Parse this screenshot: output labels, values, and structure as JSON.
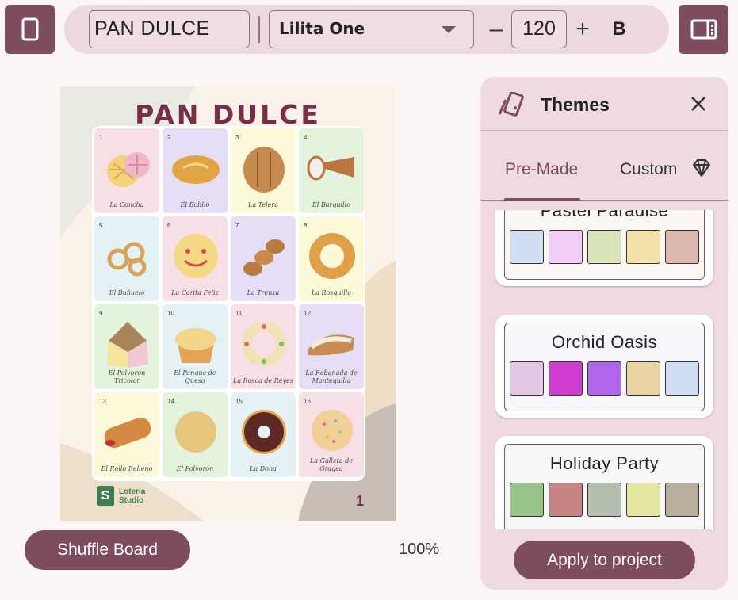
{
  "toolbar": {
    "title_value": "PAN DULCE",
    "font_value": "Lilita One",
    "minus_label": "–",
    "font_size": "120",
    "plus_label": "+",
    "bold_label": "B"
  },
  "board": {
    "title": "PAN DULCE",
    "page_number": "1",
    "logo_letter": "S",
    "logo_line1": "Loteria",
    "logo_line2": "Studio",
    "cells": [
      {
        "num": "1",
        "name": "La Concha",
        "bg": "#f7dfe6"
      },
      {
        "num": "2",
        "name": "El Bolillo",
        "bg": "#e6def5"
      },
      {
        "num": "3",
        "name": "La Telera",
        "bg": "#fbf9d8"
      },
      {
        "num": "4",
        "name": "El Barquillo",
        "bg": "#e3f3dc"
      },
      {
        "num": "5",
        "name": "El Buñuelo",
        "bg": "#e4f2f6"
      },
      {
        "num": "6",
        "name": "La Carita Feliz",
        "bg": "#f7dfe6"
      },
      {
        "num": "7",
        "name": "La Trenza",
        "bg": "#e6def5"
      },
      {
        "num": "8",
        "name": "La Rosquilla",
        "bg": "#fbf9d8"
      },
      {
        "num": "9",
        "name": "El Polvorón Tricolor",
        "bg": "#e3f3dc"
      },
      {
        "num": "10",
        "name": "El Panque de Queso",
        "bg": "#e4f2f6"
      },
      {
        "num": "11",
        "name": "La Rosca de Reyes",
        "bg": "#f7dfe6"
      },
      {
        "num": "12",
        "name": "La Rebanada de Mantequilla",
        "bg": "#e6def5"
      },
      {
        "num": "13",
        "name": "El Rollo Relleno",
        "bg": "#fbf9d8"
      },
      {
        "num": "14",
        "name": "El Polvorón",
        "bg": "#e3f3dc"
      },
      {
        "num": "15",
        "name": "La Dona",
        "bg": "#e4f2f6"
      },
      {
        "num": "16",
        "name": "La Galleta de Gragea",
        "bg": "#f7dfe6"
      }
    ]
  },
  "footer": {
    "shuffle_label": "Shuffle Board",
    "zoom": "100%"
  },
  "themes_panel": {
    "title": "Themes",
    "tabs": [
      {
        "label": "Pre-Made",
        "active": true
      },
      {
        "label": "Custom",
        "active": false
      }
    ],
    "themes": [
      {
        "name": "Pastel Paradise",
        "colors": [
          "#cfdff1",
          "#f2cdf4",
          "#d9e5b8",
          "#f0e2a8",
          "#dbb7ad"
        ]
      },
      {
        "name": "Orchid Oasis",
        "colors": [
          "#e2c6e5",
          "#cf3ed1",
          "#b266ee",
          "#ead3a3",
          "#cfddf0"
        ]
      },
      {
        "name": "Holiday Party",
        "colors": [
          "#97c587",
          "#c68583",
          "#b3bfac",
          "#e6e6a3",
          "#b9ad9d"
        ]
      }
    ],
    "apply_label": "Apply to project"
  },
  "colors": {
    "accent": "#7d4c5d",
    "panel_bg": "#eedadf",
    "title_maroon": "#7a2d48"
  }
}
